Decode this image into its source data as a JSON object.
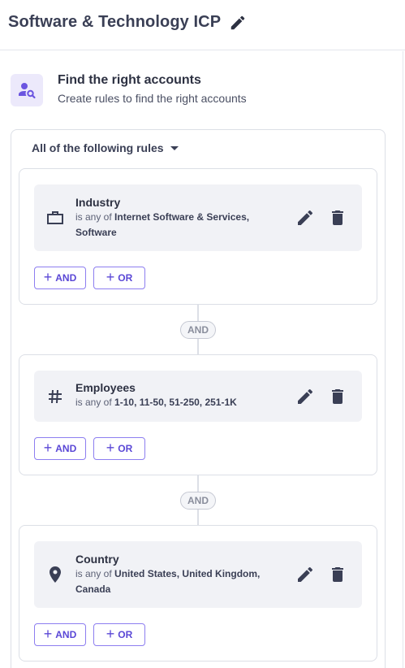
{
  "header": {
    "title": "Software & Technology ICP",
    "edit_icon": "pencil-icon"
  },
  "section": {
    "icon": "user-search-icon",
    "title": "Find the right accounts",
    "subtitle": "Create rules to find the right accounts"
  },
  "rules_mode": {
    "label": "All of the following rules",
    "icon": "caret-down-icon"
  },
  "connector_label": "AND",
  "buttons": {
    "and_label": "AND",
    "or_label": "OR",
    "plus": "+"
  },
  "rules": [
    {
      "name": "Industry",
      "icon": "briefcase-icon",
      "operator": "is any of",
      "values": "Internet Software & Services, Software"
    },
    {
      "name": "Employees",
      "icon": "hash-icon",
      "operator": "is any of",
      "values": "1-10, 11-50, 51-250, 251-1K"
    },
    {
      "name": "Country",
      "icon": "location-pin-icon",
      "operator": "is any of",
      "values": "United States, United Kingdom, Canada"
    }
  ],
  "colors": {
    "accent": "#5a47d6",
    "accent_border": "#8d7ef0",
    "icon_bg": "#ece9fb",
    "card_inner": "#f1f2f6"
  }
}
